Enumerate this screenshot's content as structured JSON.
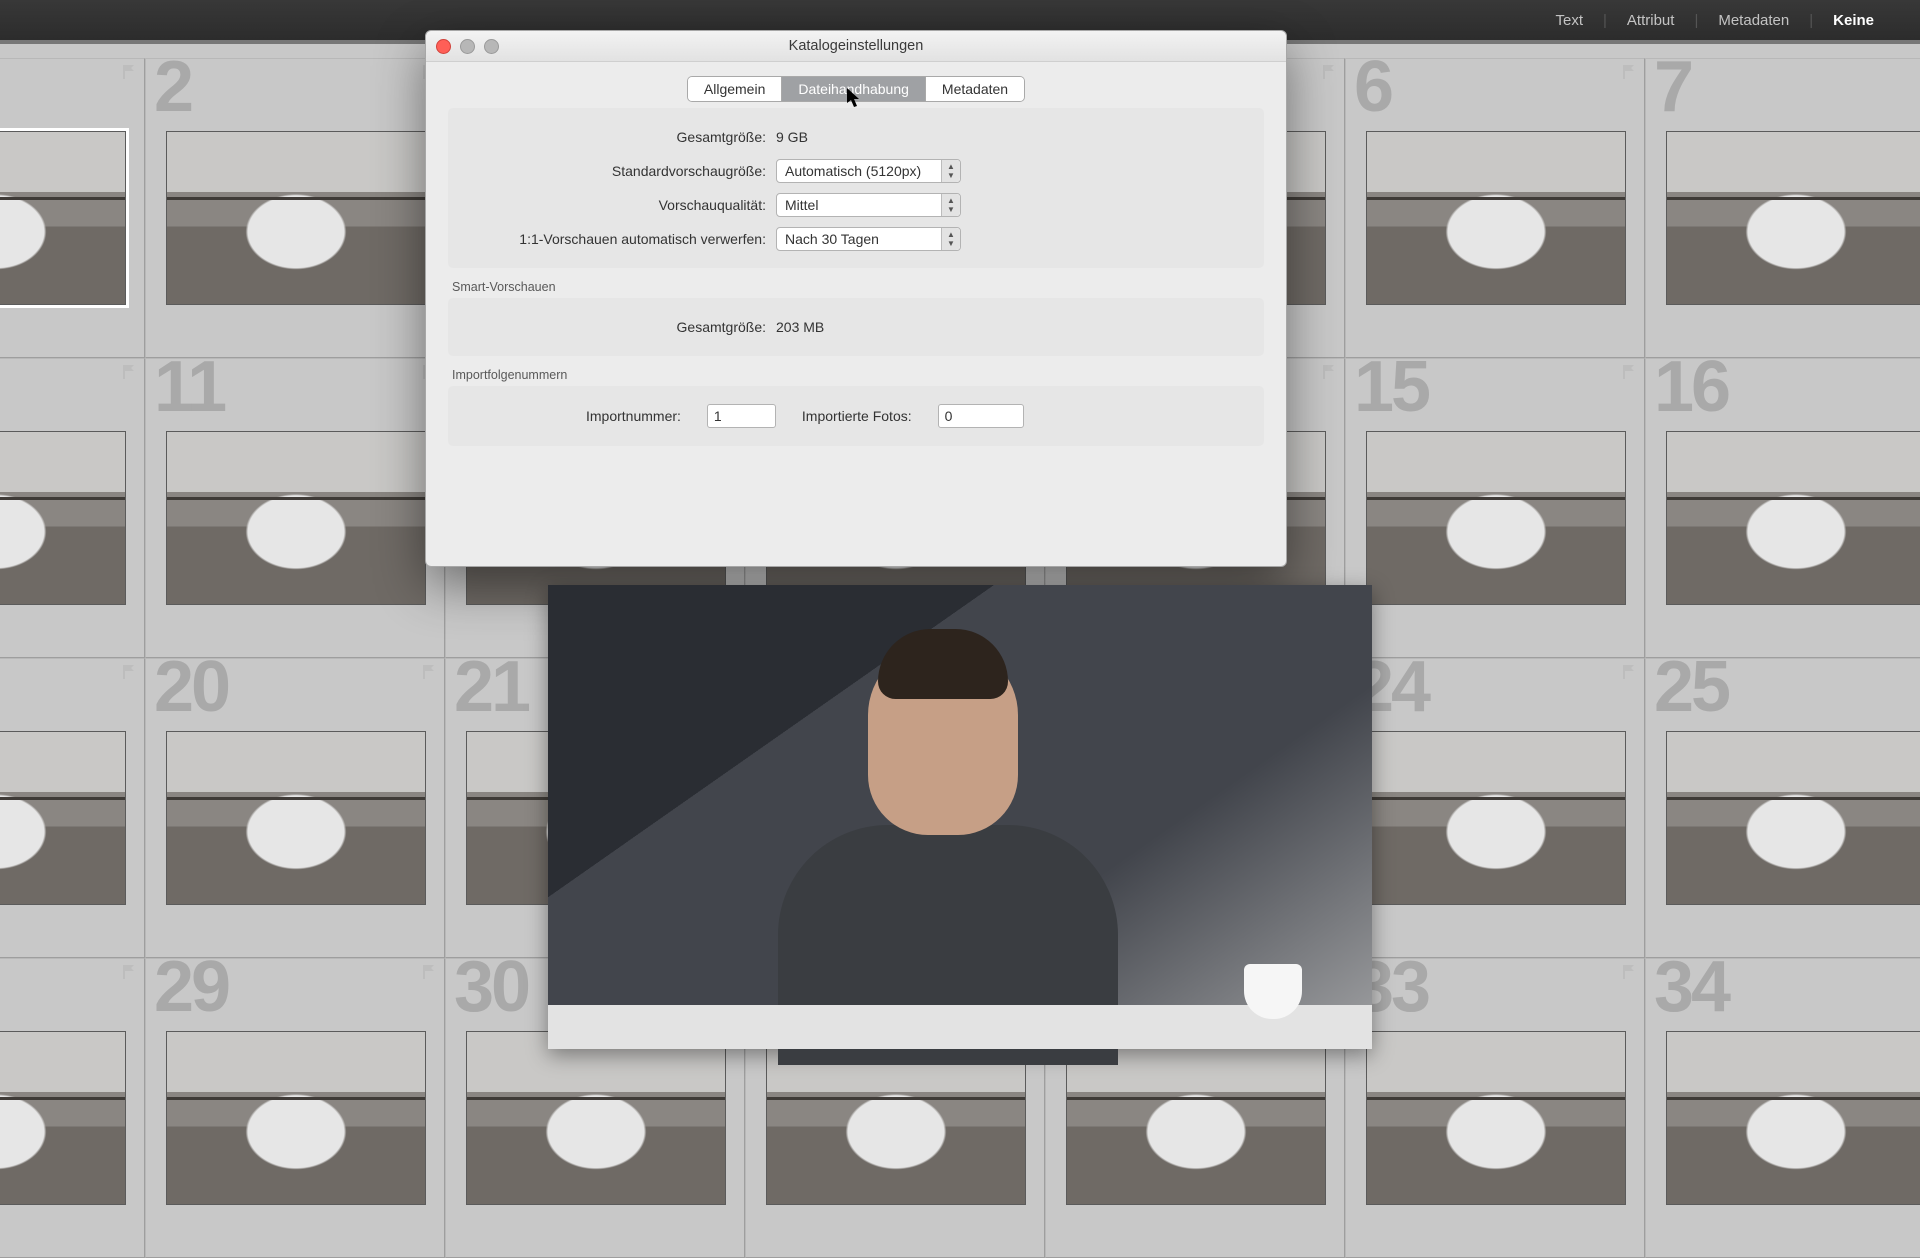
{
  "toolbar": {
    "items": [
      "Text",
      "Attribut",
      "Metadaten",
      "Keine"
    ],
    "selectedIndex": 3
  },
  "grid": {
    "cols": 7,
    "rows": 4,
    "startNumber": 1,
    "showNumbers": true,
    "firstRowNumbers": [
      "",
      "2",
      "",
      "",
      "",
      "6",
      "7"
    ],
    "numbers": [
      [
        "",
        "2",
        "",
        "",
        "",
        "6",
        "7"
      ],
      [
        "",
        "11",
        "",
        "",
        "",
        "15",
        "16"
      ],
      [
        "",
        "20",
        "21",
        "",
        "",
        "24",
        "25"
      ],
      [
        "",
        "29",
        "30",
        "",
        "",
        "33",
        "34"
      ]
    ],
    "selected": [
      0,
      0
    ]
  },
  "dialog": {
    "title": "Katalogeinstellungen",
    "tabs": [
      "Allgemein",
      "Dateihandhabung",
      "Metadaten"
    ],
    "activeTab": 1,
    "previews": {
      "totalSizeLabel": "Gesamtgröße:",
      "totalSize": "9 GB",
      "stdSizeLabel": "Standardvorschaugröße:",
      "stdSize": "Automatisch (5120px)",
      "qualityLabel": "Vorschauqualität:",
      "quality": "Mittel",
      "discardLabel": "1:1-Vorschauen automatisch verwerfen:",
      "discard": "Nach 30 Tagen"
    },
    "smart": {
      "heading": "Smart-Vorschauen",
      "totalSizeLabel": "Gesamtgröße:",
      "totalSize": "203 MB"
    },
    "import": {
      "heading": "Importfolgenummern",
      "numLabel": "Importnummer:",
      "num": "1",
      "photosLabel": "Importierte Fotos:",
      "photos": "0"
    }
  }
}
